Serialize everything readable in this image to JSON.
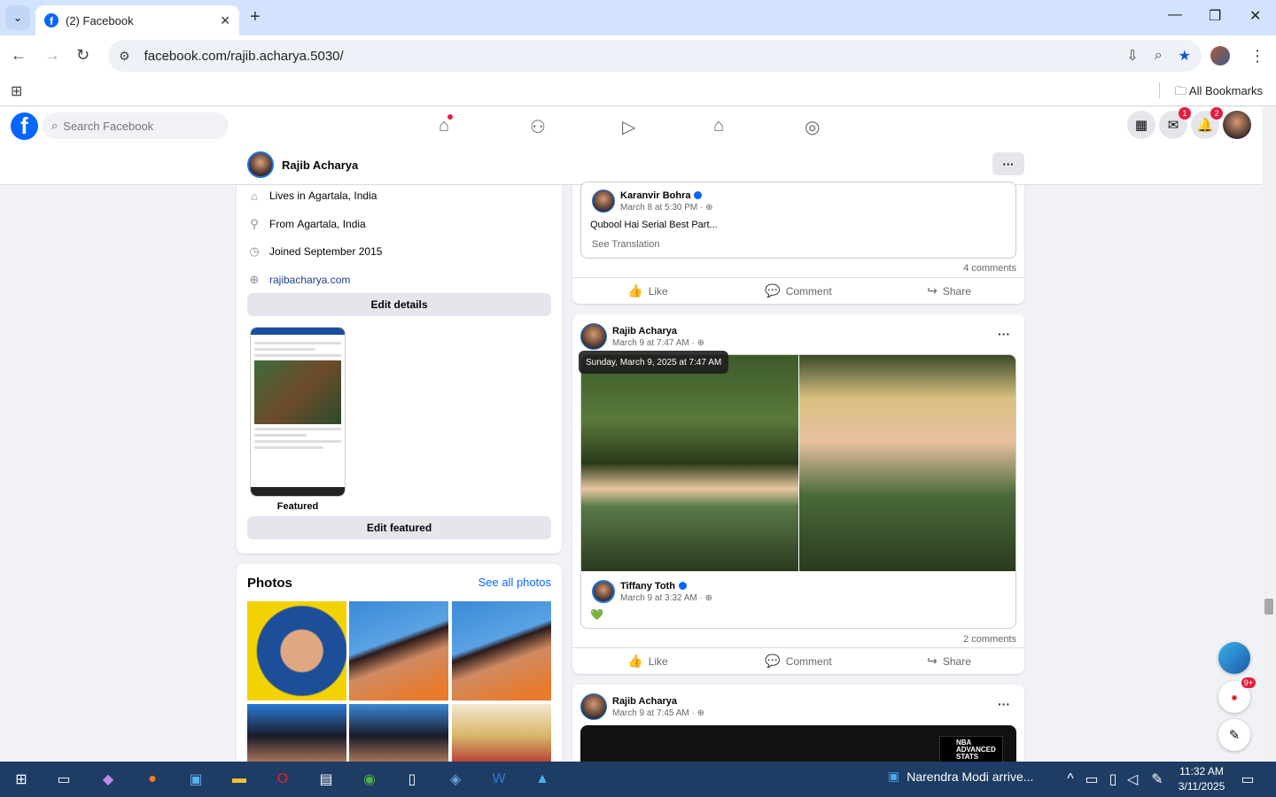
{
  "browser": {
    "tab_title": "(2) Facebook",
    "url": "facebook.com/rajib.acharya.5030/",
    "bookmarks_label": "All Bookmarks"
  },
  "fb": {
    "search_placeholder": "Search Facebook",
    "messenger_badge": "1",
    "notif_badge": "2"
  },
  "profile": {
    "name": "Rajib Acharya",
    "intro": {
      "lives_prefix": "Lives in ",
      "lives": "Agartala, India",
      "from_prefix": "From ",
      "from": "Agartala, India",
      "joined": "Joined September 2015",
      "website": "rajibacharya.com",
      "edit_details": "Edit details",
      "featured_label": "Featured",
      "edit_featured": "Edit featured"
    },
    "photos": {
      "title": "Photos",
      "see_all": "See all photos"
    }
  },
  "posts": [
    {
      "shared_author": "Karanvir Bohra",
      "shared_meta": "March 8 at 5:30 PM ·",
      "shared_text": "Qubool Hai Serial Best Part...",
      "see_translation": "See Translation",
      "comments": "4 comments"
    },
    {
      "author": "Rajib Acharya",
      "meta": "March 9 at 7:47 AM ·",
      "tooltip": "Sunday, March 9, 2025 at 7:47 AM",
      "shared_author": "Tiffany Toth",
      "shared_meta": "March 9 at 3:32 AM ·",
      "shared_text": "💚",
      "comments": "2 comments"
    },
    {
      "author": "Rajib Acharya",
      "meta": "March 9 at 7:45 AM ·",
      "badge_text": "NBA ADVANCED STATS"
    }
  ],
  "actions": {
    "like": "Like",
    "comment": "Comment",
    "share": "Share"
  },
  "taskbar": {
    "news": "Narendra Modi arrive...",
    "time": "11:32 AM",
    "date": "3/11/2025",
    "news_badge": "9+"
  }
}
